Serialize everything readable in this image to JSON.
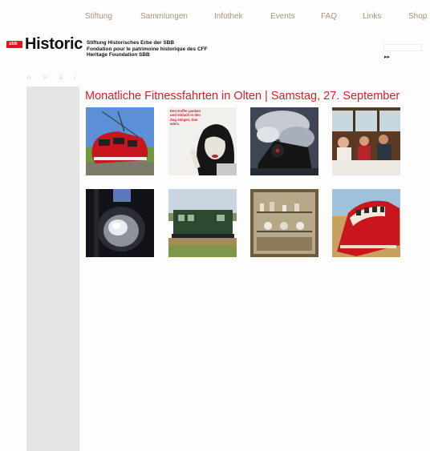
{
  "nav": {
    "items": [
      {
        "label": "Stiftung"
      },
      {
        "label": "Sammlungen"
      },
      {
        "label": "Infothek"
      },
      {
        "label": "Events"
      },
      {
        "label": "FAQ"
      },
      {
        "label": "Links"
      },
      {
        "label": "Shop"
      }
    ]
  },
  "brand": {
    "logo_text": "sbb",
    "name": "Historic",
    "lines": [
      "Stiftung Historisches Erbe der SBB",
      "Fondation pour le patrimoine historique des CFF",
      "Heritage Foundation SBB"
    ]
  },
  "search": {
    "go_label": "▸▸"
  },
  "languages": [
    "D",
    "F",
    "E",
    "I"
  ],
  "headline": "Monatliche Fitnessfahrten in Olten   |   Samstag, 27. September",
  "poster_text": "Den Koffer packen und einfach in den Zug steigen. Das wär's.",
  "colors": {
    "accent_red": "#d2232a",
    "nav_text": "#a8947a",
    "sidebar_bg": "#e5e5e5"
  },
  "gallery": [
    {
      "icon": "red-arrow-railcar-photo"
    },
    {
      "icon": "vintage-poster-woman-photo"
    },
    {
      "icon": "steam-locomotive-smoke-photo"
    },
    {
      "icon": "dining-car-passengers-photo"
    },
    {
      "icon": "locomotive-headlamp-photo"
    },
    {
      "icon": "green-electric-locomotive-photo"
    },
    {
      "icon": "museum-display-cabinet-photo"
    },
    {
      "icon": "red-train-curve-photo"
    }
  ]
}
